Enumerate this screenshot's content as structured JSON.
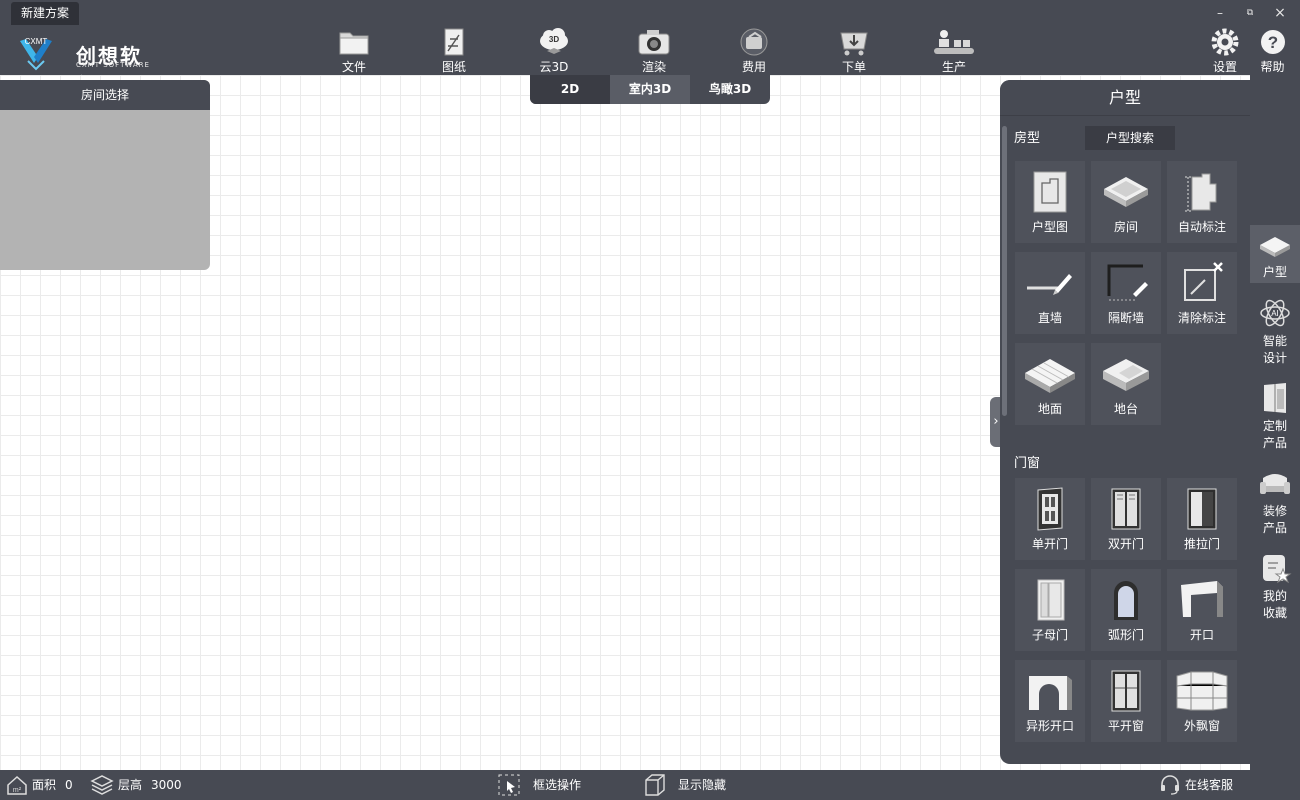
{
  "window": {
    "doc_tab": "新建方案",
    "minimize": "–",
    "restore": "⧉",
    "close": "×"
  },
  "logo": {
    "brand": "创想软件",
    "sub": "CXMT SOFTWARE",
    "mark": "CXMT"
  },
  "toolbar": {
    "items": [
      {
        "label": "文件",
        "icon": "folder-icon"
      },
      {
        "label": "图纸",
        "icon": "drawing-icon"
      },
      {
        "label": "云3D",
        "icon": "cloud-3d-icon",
        "badge": "3D"
      },
      {
        "label": "渲染",
        "icon": "camera-icon"
      },
      {
        "label": "费用",
        "icon": "wallet-icon"
      },
      {
        "label": "下单",
        "icon": "cart-icon"
      },
      {
        "label": "生产",
        "icon": "production-icon"
      }
    ],
    "settings": "设置",
    "help": "帮助"
  },
  "views": [
    "2D",
    "室内3D",
    "鸟瞰3D"
  ],
  "room_panel": {
    "title": "房间选择"
  },
  "library": {
    "title": "户型",
    "search": "户型搜索",
    "sections": [
      {
        "name": "房型",
        "items": [
          "户型图",
          "房间",
          "自动标注",
          "直墙",
          "隔断墙",
          "清除标注",
          "地面",
          "地台"
        ]
      },
      {
        "name": "门窗",
        "items": [
          "单开门",
          "双开门",
          "推拉门",
          "子母门",
          "弧形门",
          "开口",
          "异形开口",
          "平开窗",
          "外飘窗"
        ]
      }
    ]
  },
  "sidebar": [
    {
      "label": "户型",
      "icon": "house-icon"
    },
    {
      "label": "智能设计",
      "line1": "智能",
      "line2": "设计",
      "icon": "ai-icon"
    },
    {
      "label": "定制产品",
      "line1": "定制",
      "line2": "产品",
      "icon": "wardrobe-icon"
    },
    {
      "label": "装修产品",
      "line1": "装修",
      "line2": "产品",
      "icon": "sofa-icon"
    },
    {
      "label": "我的收藏",
      "line1": "我的",
      "line2": "收藏",
      "icon": "favorite-icon"
    }
  ],
  "status": {
    "area_label": "面积",
    "area_value": "0",
    "height_label": "层高",
    "height_value": "3000",
    "box_select": "框选操作",
    "show_hide": "显示隐藏",
    "service": "在线客服"
  },
  "colors": {
    "chrome": "#474a53",
    "panel": "#4f525b",
    "room_panel": "#b3b3b3"
  }
}
